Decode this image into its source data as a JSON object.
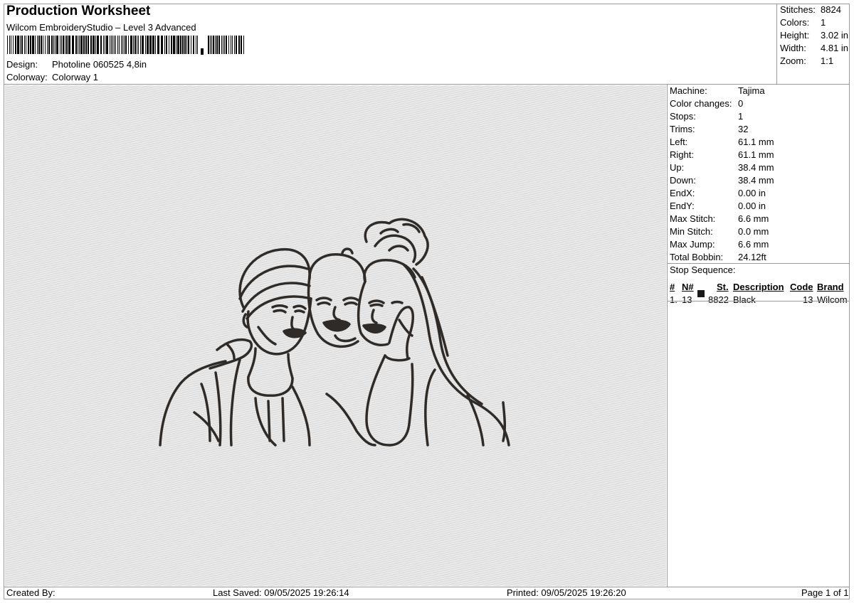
{
  "header": {
    "title": "Production Worksheet",
    "software": "Wilcom EmbroideryStudio – Level 3 Advanced",
    "barcode_icon": "barcode-icon",
    "design_label": "Design:",
    "design_value": "Photoline 060525 4,8in",
    "colorway_label": "Colorway:",
    "colorway_value": "Colorway 1"
  },
  "summary": {
    "stitches_label": "Stitches:",
    "stitches": "8824",
    "colors_label": "Colors:",
    "colors": "1",
    "height_label": "Height:",
    "height": "3.02 in",
    "width_label": "Width:",
    "width": "4.81 in",
    "zoom_label": "Zoom:",
    "zoom": "1:1"
  },
  "machine": {
    "machine_label": "Machine:",
    "machine": "Tajima",
    "color_changes_label": "Color changes:",
    "color_changes": "0",
    "stops_label": "Stops:",
    "stops": "1",
    "trims_label": "Trims:",
    "trims": "32",
    "left_label": "Left:",
    "left": "61.1 mm",
    "right_label": "Right:",
    "right": "61.1 mm",
    "up_label": "Up:",
    "up": "38.4 mm",
    "down_label": "Down:",
    "down": "38.4 mm",
    "endx_label": "EndX:",
    "endx": "0.00 in",
    "endy_label": "EndY:",
    "endy": "0.00 in",
    "max_stitch_label": "Max Stitch:",
    "max_stitch": "6.6 mm",
    "min_stitch_label": "Min Stitch:",
    "min_stitch": "0.0 mm",
    "max_jump_label": "Max Jump:",
    "max_jump": "6.6 mm",
    "total_bobbin_label": "Total Bobbin:",
    "total_bobbin": "24.12ft"
  },
  "stop_sequence": {
    "title": "Stop Sequence:",
    "headers": {
      "num": "#",
      "n": "N#",
      "st": "St.",
      "description": "Description",
      "code": "Code",
      "brand": "Brand"
    },
    "rows": [
      {
        "num": "1.",
        "n": "13",
        "st": "8822",
        "description": "Black",
        "code": "13",
        "brand": "Wilcom",
        "color": "#1a1a1a"
      }
    ]
  },
  "design_preview": {
    "thread_color": "#2e2b28",
    "background": "#e6e6e6",
    "icon": "embroidery-line-art-three-women"
  },
  "footer": {
    "created_by": "Created By:",
    "last_saved": "Last Saved: 09/05/2025 19:26:14",
    "printed": "Printed: 09/05/2025 19:26:20",
    "page": "Page 1 of 1"
  }
}
